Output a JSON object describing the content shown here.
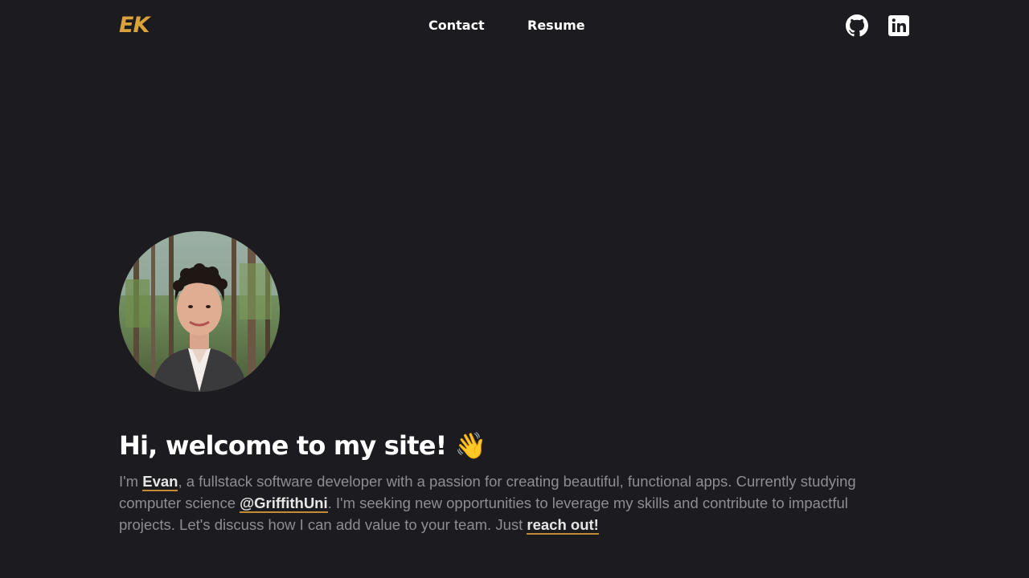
{
  "header": {
    "logo_text": "EK",
    "nav": {
      "contact_label": "Contact",
      "resume_label": "Resume"
    },
    "social": {
      "github_icon": "github-icon",
      "linkedin_icon": "linkedin-icon"
    }
  },
  "hero": {
    "avatar_icon": "profile-photo",
    "heading": "Hi, welcome to my site!",
    "heading_emoji": "👋",
    "intro": {
      "part1": "I'm ",
      "name_link": "Evan",
      "part2": ", a fullstack software developer with a passion for creating beautiful, functional apps. Currently studying computer science ",
      "uni_link": "@GriffithUni",
      "part3": ". I'm seeking new opportunities to leverage my skills and contribute to impactful projects. Let's discuss how I can add value to your team. Just ",
      "reach_link": "reach out!"
    }
  },
  "colors": {
    "background": "#1c1b20",
    "accent": "#d9a23a",
    "text_muted": "#8e8d93",
    "text_bright": "#ffffff"
  }
}
